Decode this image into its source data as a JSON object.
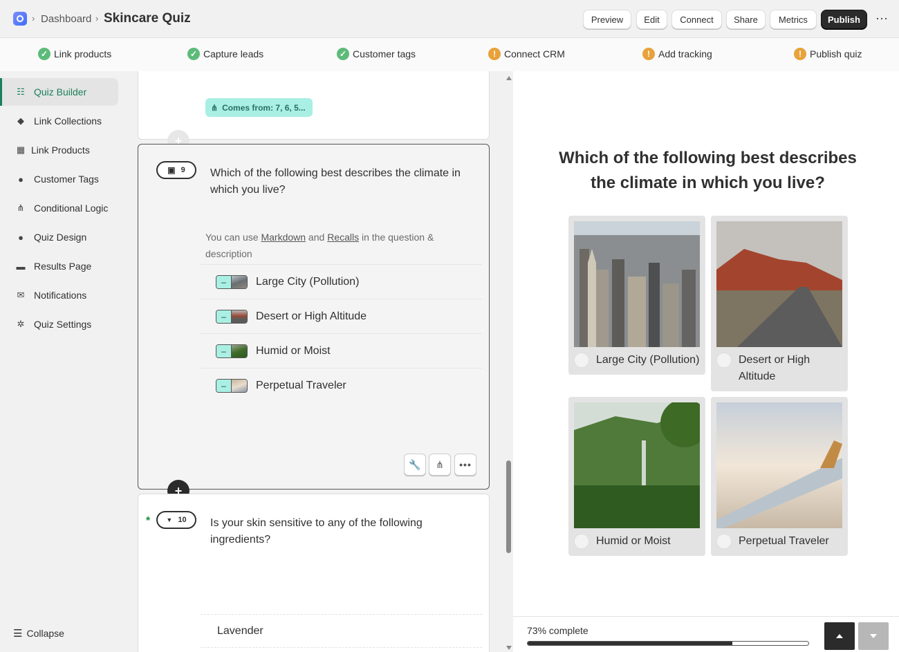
{
  "header": {
    "breadcrumb_link": "Dashboard",
    "title": "Skincare Quiz",
    "buttons": [
      "Preview",
      "Edit",
      "Connect",
      "Share",
      "Metrics",
      "Publish"
    ]
  },
  "checklist": [
    {
      "label": "Link products",
      "status": "done"
    },
    {
      "label": "Capture leads",
      "status": "done"
    },
    {
      "label": "Customer tags",
      "status": "done"
    },
    {
      "label": "Connect CRM",
      "status": "warning"
    },
    {
      "label": "Add tracking",
      "status": "warning"
    },
    {
      "label": "Publish quiz",
      "status": "warning"
    }
  ],
  "sidebar": {
    "items": [
      {
        "label": "Quiz Builder",
        "icon": "list-icon"
      },
      {
        "label": "Link Collections",
        "icon": "tag-icon"
      },
      {
        "label": "Link Products",
        "icon": "box-icon"
      },
      {
        "label": "Customer Tags",
        "icon": "person-icon"
      },
      {
        "label": "Conditional Logic",
        "icon": "branch-icon"
      },
      {
        "label": "Quiz Design",
        "icon": "drop-icon"
      },
      {
        "label": "Results Page",
        "icon": "cart-icon"
      },
      {
        "label": "Notifications",
        "icon": "mail-icon"
      },
      {
        "label": "Quiz Settings",
        "icon": "gear-icon"
      }
    ],
    "collapse_label": "Collapse"
  },
  "editor": {
    "comes_from": "Comes from: 7, 6, 5...",
    "question9": {
      "number": "9",
      "text_line1": "Which of the following best describes the climate in",
      "text_line2": "which you live?",
      "hint_pre": "You can use ",
      "hint_markdown": "Markdown",
      "hint_and": " and ",
      "hint_recalls": "Recalls",
      "hint_post": " in the question &",
      "hint_line2": "description",
      "options": [
        "Large City (Pollution)",
        "Desert or High Altitude",
        "Humid or Moist",
        "Perpetual Traveler"
      ]
    },
    "question10": {
      "number": "10",
      "text_line1": "Is your skin sensitive to any of the following",
      "text_line2": "ingredients?",
      "options": [
        "Lavender"
      ]
    }
  },
  "preview": {
    "question_line1": "Which of the following best describes",
    "question_line2": "the climate in which you live?",
    "answers": [
      "Large City (Pollution)",
      "Desert or High Altitude",
      "Humid or Moist",
      "Perpetual Traveler"
    ],
    "progress_text": "73% complete",
    "progress": 0.73
  }
}
